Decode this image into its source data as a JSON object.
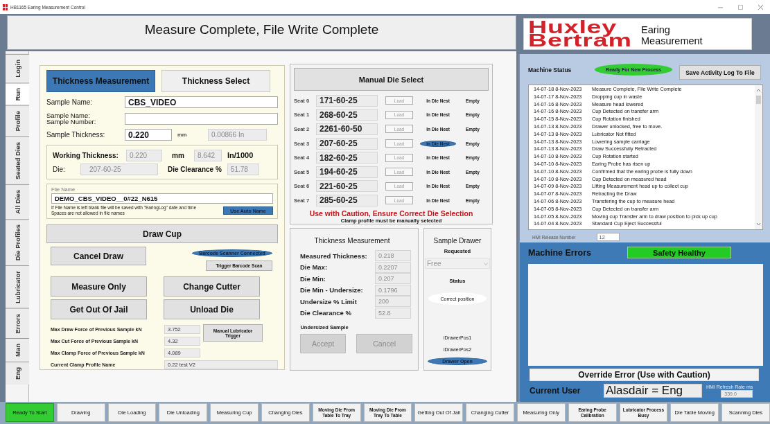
{
  "window": {
    "title": "HB1165 Earing Measurement Control"
  },
  "header": {
    "message": "Measure Complete, File Write Complete"
  },
  "side_tabs": [
    {
      "label": "Login",
      "selected": false
    },
    {
      "label": "Run",
      "selected": true
    },
    {
      "label": "Profile",
      "selected": false
    },
    {
      "label": "Seated Dies",
      "selected": false
    },
    {
      "label": "All Dies",
      "selected": false
    },
    {
      "label": "Die Profiles",
      "selected": false
    },
    {
      "label": "Lubricator",
      "selected": false
    },
    {
      "label": "Errors",
      "selected": false
    },
    {
      "label": "Man",
      "selected": false
    },
    {
      "label": "Eng",
      "selected": false
    }
  ],
  "thickness_panel": {
    "tabs": [
      {
        "label": "Thickness Measurement",
        "selected": true
      },
      {
        "label": "Thickness Select",
        "selected": false
      }
    ],
    "sample_name": {
      "label": "Sample Name:",
      "value": "CBS_VIDEO"
    },
    "sample_number": {
      "label_lines": [
        "Sample Name:",
        "Sample Number:"
      ]
    },
    "thickness": {
      "label": "Sample Thickness:",
      "value": "0.220",
      "unit": "mm",
      "inches": "0.00866 In"
    },
    "working": {
      "label": "Working Thickness:",
      "value": "0.220",
      "unit": "mm",
      "thou": "8.642",
      "thou_unit": "In/1000",
      "die_label": "Die:",
      "die": "207-60-25",
      "clearance_label": "Die Clearance %",
      "clearance": "51.78"
    },
    "file": {
      "label": "File Name",
      "value": "DEMO_CBS_VIDEO__0#22_N615",
      "notes": [
        "If File Name is left blank file will be saved with \"EaringLog\" date and time",
        "Spaces are not allowed in file names"
      ],
      "button": "Use Auto Name"
    },
    "draw_button": "Draw Cup",
    "cancel_button": "Cancel Draw",
    "barcode": {
      "label": "Barcode Scanner Connected",
      "on": true
    },
    "trigger_button": "Trigger Barcode Scan",
    "actions": [
      "Measure Only",
      "Change Cutter",
      "Get Out Of Jail",
      "Unload Die"
    ],
    "forces": [
      {
        "label": "Max Draw Force of Previous Sample kN",
        "value": "3.752"
      },
      {
        "label": "Max Cut Force of Previous Sample kN",
        "value": "4.32"
      },
      {
        "label": "Max Clamp Force of Previous Sample kN",
        "value": "4.089"
      },
      {
        "label": "Current Clamp Profile Name",
        "value": "0.22 test V2"
      }
    ],
    "lube_button": "Manual Lubricator Trigger"
  },
  "die_select": {
    "title": "Manual Die Select",
    "seats": [
      {
        "seat": "Seat 0",
        "die": "171-60-25",
        "load": "Load",
        "load_disabled": true,
        "nest": "In Die Nest",
        "nest_on": false,
        "status": "Empty"
      },
      {
        "seat": "Seat 1",
        "die": "268-60-25",
        "load": "Load",
        "load_disabled": true,
        "nest": "In Die Nest",
        "nest_on": false,
        "status": "Empty"
      },
      {
        "seat": "Seat 2",
        "die": "2261-60-50",
        "load": "Load",
        "load_disabled": true,
        "nest": "In Die Nest",
        "nest_on": false,
        "status": "Empty"
      },
      {
        "seat": "Seat 3",
        "die": "207-60-25",
        "load": "Load",
        "load_disabled": true,
        "nest": "In Die Nest",
        "nest_on": true,
        "status": "Empty"
      },
      {
        "seat": "Seat 4",
        "die": "182-60-25",
        "load": "Load",
        "load_disabled": true,
        "nest": "In Die Nest",
        "nest_on": false,
        "status": "Empty"
      },
      {
        "seat": "Seat 5",
        "die": "194-60-25",
        "load": "Load",
        "load_disabled": true,
        "nest": "In Die Nest",
        "nest_on": false,
        "status": "Empty"
      },
      {
        "seat": "Seat 6",
        "die": "221-60-25",
        "load": "Load",
        "load_disabled": true,
        "nest": "In Die Nest",
        "nest_on": false,
        "status": "Empty"
      },
      {
        "seat": "Seat 7",
        "die": "285-60-25",
        "load": "Load",
        "load_disabled": true,
        "nest": "In Die Nest",
        "nest_on": false,
        "status": "Empty"
      }
    ],
    "warning": "Use with Caution, Ensure Correct Die Selection",
    "note": "Clamp profile must be manually selected"
  },
  "measurement": {
    "title": "Thickness Measurement",
    "rows": [
      {
        "label": "Measured Thickness:",
        "value": "0.218"
      },
      {
        "label": "Die Max:",
        "value": "0.2207"
      },
      {
        "label": "Die Min:",
        "value": "0.207"
      },
      {
        "label": "Die Min - Undersize:",
        "value": "0.1796"
      },
      {
        "label": "Undersize % Limit",
        "value": "200"
      },
      {
        "label": "Die Clearance %",
        "value": "52.8"
      }
    ],
    "undersized": "Undersized Sample",
    "buttons": [
      {
        "label": "Accept",
        "disabled": true
      },
      {
        "label": "Cancel",
        "disabled": true
      }
    ]
  },
  "drawer": {
    "title": "Sample Drawer",
    "requested_label": "Requested",
    "requested": {
      "value": "Free",
      "disabled": true
    },
    "status_label": "Status",
    "status": "Correct position",
    "indicators": [
      {
        "label": "iDrawerPos1",
        "on": false
      },
      {
        "label": "iDrawerPos2",
        "on": false
      },
      {
        "label": "Drawer Open",
        "on": true
      }
    ]
  },
  "logo": {
    "line1": "Huxley",
    "line2": "Bertram",
    "product_lines": [
      "Earing",
      "Measurement"
    ]
  },
  "machine_status": {
    "label": "Machine Status",
    "state": "Ready For New Process",
    "save_button": "Save Activity Log To File",
    "log": [
      {
        "time": "14-07-18 8-Nov-2023",
        "message": "Measure Complete, File Write Complete"
      },
      {
        "time": "14-07-17 8-Nov-2023",
        "message": "Dropping cup in waste"
      },
      {
        "time": "14-07-16 8-Nov-2023",
        "message": "Measure head lowered"
      },
      {
        "time": "14-07-16 8-Nov-2023",
        "message": "Cup Detected on transfer arm"
      },
      {
        "time": "14-07-15 8-Nov-2023",
        "message": "Cup Rotation finished"
      },
      {
        "time": "14-07-13 8-Nov-2023",
        "message": "Drawer unlocked, free to move."
      },
      {
        "time": "14-07-13 8-Nov-2023",
        "message": "Lubricator Not fitted"
      },
      {
        "time": "14-07-13 8-Nov-2023",
        "message": "Lowering sample carriage"
      },
      {
        "time": "14-07-13 8-Nov-2023",
        "message": "Draw Successfully Retracted"
      },
      {
        "time": "14-07-10 8-Nov-2023",
        "message": "Cup Rotation started"
      },
      {
        "time": "14-07-10 8-Nov-2023",
        "message": "Earing Probe has risen up"
      },
      {
        "time": "14-07-10 8-Nov-2023",
        "message": "Confirmed that the earing probe is fully down"
      },
      {
        "time": "14-07-10 8-Nov-2023",
        "message": "Cup Detected on measured head"
      },
      {
        "time": "14-07-09 8-Nov-2023",
        "message": "Lifting Measurement head up to collect cup"
      },
      {
        "time": "14-07-07 8-Nov-2023",
        "message": "Retracting the Draw"
      },
      {
        "time": "14-07-06 8-Nov-2023",
        "message": "Transfering the cup to measure head"
      },
      {
        "time": "14-07-05 8-Nov-2023",
        "message": "Cup Detected on transfer arm"
      },
      {
        "time": "14-07-05 8-Nov-2023",
        "message": "Moving cup Transfer arm to draw position to pick up cup"
      },
      {
        "time": "14-07-04 8-Nov-2023",
        "message": "Standard Cup Eject Successful"
      }
    ],
    "release_label": "HMI Release Number",
    "release": "12"
  },
  "errors": {
    "label": "Machine Errors",
    "safety": "Safety Healthy",
    "override_button": "Override Error (Use with Caution)",
    "user_label": "Current User",
    "user": "Alasdair = Eng",
    "refresh_label": "HMI Refresh Rate ms",
    "refresh": "339.0"
  },
  "process_steps": [
    {
      "label": "Ready To Start",
      "on": true
    },
    {
      "label": "Drawing",
      "on": false
    },
    {
      "label": "Die Loading",
      "on": false
    },
    {
      "label": "Die Unloading",
      "on": false
    },
    {
      "label": "Measuring Cup",
      "on": false
    },
    {
      "label": "Changing Dies",
      "on": false
    },
    {
      "label": "Moving Die From Table To Tray",
      "on": false
    },
    {
      "label": "Moving Die From Tray To Table",
      "on": false
    },
    {
      "label": "Getting Out Of Jail",
      "on": false
    },
    {
      "label": "Changing Cutter",
      "on": false
    },
    {
      "label": "Measuring Only",
      "on": false
    },
    {
      "label": "Earing Probe Calibration",
      "on": false
    },
    {
      "label": "Lubricator Process Busy",
      "on": false
    },
    {
      "label": "Die Table Moving",
      "on": false
    },
    {
      "label": "Scanning Dies",
      "on": false
    }
  ]
}
